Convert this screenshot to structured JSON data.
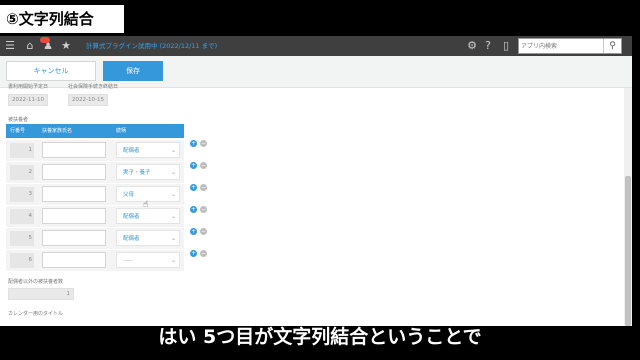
{
  "overlay": {
    "title": "⑤文字列結合",
    "caption": "はい 5つ目が文字列結合ということで"
  },
  "topbar": {
    "app_title": "計算式プラグイン試用中 (2022/12/11 まで)",
    "search_placeholder": "アプリ内検索"
  },
  "actions": {
    "cancel": "キャンセル",
    "save": "保存"
  },
  "dates": {
    "label1": "書利用開始予定日",
    "label2": "社会保険手続き終結日",
    "value1": "2022-11-10",
    "value2": "2022-10-15"
  },
  "table": {
    "section_label": "被扶養者",
    "headers": [
      "行番号",
      "扶養家族氏名",
      "続柄"
    ],
    "rows": [
      {
        "num": "1",
        "relation": "配偶者"
      },
      {
        "num": "2",
        "relation": "実子・養子"
      },
      {
        "num": "3",
        "relation": "父母"
      },
      {
        "num": "4",
        "relation": "配偶者"
      },
      {
        "num": "5",
        "relation": "配偶者"
      },
      {
        "num": "6",
        "relation": "-----"
      }
    ]
  },
  "footer_fields": {
    "count_label": "配偶者以外の被扶養者数",
    "count_value": "1",
    "calendar_label": "カレンダー用のタイトル"
  },
  "colors": {
    "accent": "#3498db",
    "topbar": "#3f3f3f"
  }
}
